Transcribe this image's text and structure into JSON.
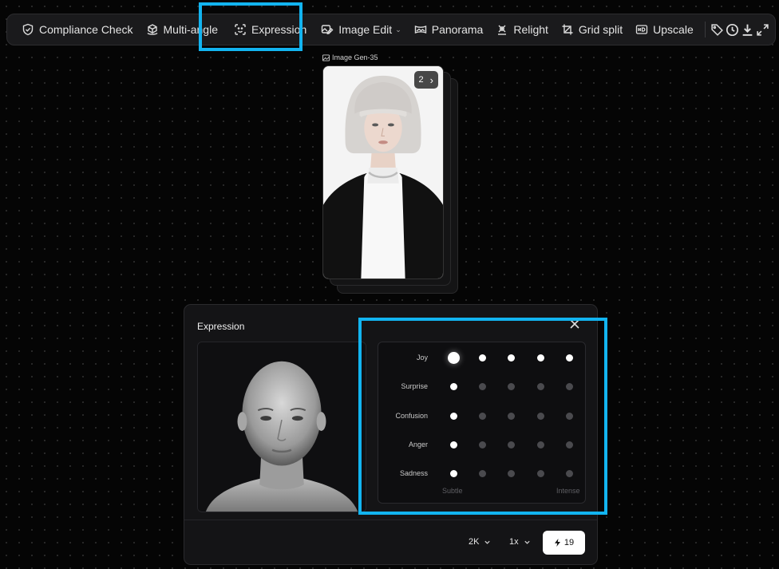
{
  "toolbar": {
    "items": [
      {
        "label": "Compliance Check",
        "icon": "shield-check-icon"
      },
      {
        "label": "Multi-angle",
        "icon": "cube-rotate-icon"
      },
      {
        "label": "Expression",
        "icon": "face-scan-icon"
      },
      {
        "label": "Image Edit",
        "icon": "edit-image-icon",
        "has_dropdown": true
      },
      {
        "label": "Panorama",
        "icon": "panorama-icon"
      },
      {
        "label": "Relight",
        "icon": "relight-icon"
      },
      {
        "label": "Grid split",
        "icon": "crop-icon"
      },
      {
        "label": "Upscale",
        "icon": "hd-icon"
      }
    ],
    "icon_buttons": [
      "tag-icon",
      "history-icon",
      "download-icon",
      "expand-icon"
    ]
  },
  "card": {
    "label": "Image Gen-35",
    "count": "2"
  },
  "panel": {
    "title": "Expression",
    "emotions": [
      {
        "label": "Joy",
        "level": 5
      },
      {
        "label": "Surprise",
        "level": 1
      },
      {
        "label": "Confusion",
        "level": 1
      },
      {
        "label": "Anger",
        "level": 1
      },
      {
        "label": "Sadness",
        "level": 1
      }
    ],
    "levels": 5,
    "scale_low": "Subtle",
    "scale_high": "Intense",
    "resolution": "2K",
    "multiplier": "1x",
    "cost": "19"
  },
  "colors": {
    "highlight": "#12b4f0",
    "background": "#050505",
    "panel": "#141416"
  }
}
